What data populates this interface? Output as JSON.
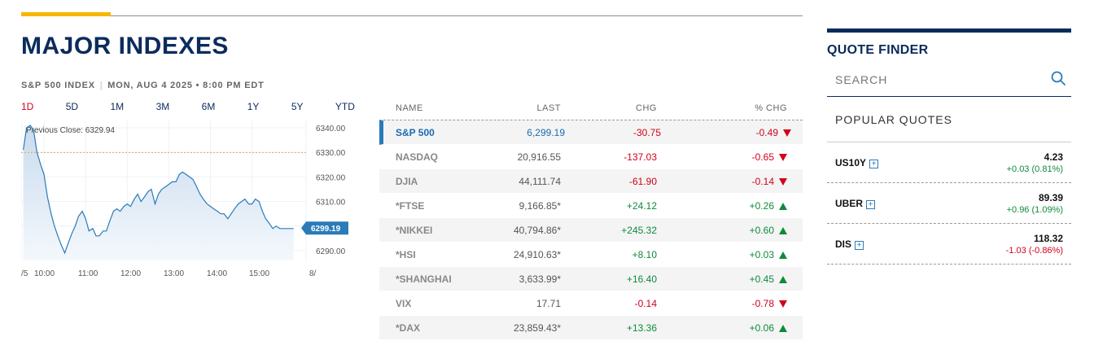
{
  "header": {
    "title": "MAJOR INDEXES"
  },
  "chart_meta": {
    "index": "S&P 500 INDEX",
    "date": "MON, AUG 4 2025 • 8:00 PM EDT"
  },
  "range_tabs": [
    "1D",
    "5D",
    "1M",
    "3M",
    "6M",
    "1Y",
    "5Y",
    "YTD"
  ],
  "range_active": "1D",
  "chart_data": {
    "type": "area",
    "previous_close_label": "Previous Close: 6329.94",
    "previous_close": 6329.94,
    "current_label": "6299.19",
    "current": 6299.19,
    "y_ticks": [
      "6340.00",
      "6330.00",
      "6320.00",
      "6310.00",
      "6300.00",
      "6290.00"
    ],
    "x_ticks": [
      "/5",
      "10:00",
      "11:00",
      "12:00",
      "13:00",
      "14:00",
      "15:00",
      "8/"
    ],
    "ylim": [
      6286,
      6343
    ],
    "series": [
      {
        "x": [
          9.5,
          9.58,
          9.67,
          9.75,
          9.83,
          9.92,
          10.0,
          10.08,
          10.17,
          10.25,
          10.33,
          10.42,
          10.5,
          10.58,
          10.67,
          10.75,
          10.83,
          10.92,
          11.0,
          11.08,
          11.17,
          11.25,
          11.33,
          11.42,
          11.5,
          11.58,
          11.67,
          11.75,
          11.83,
          11.92,
          12.0,
          12.08,
          12.17,
          12.25,
          12.33,
          12.42,
          12.5,
          12.58,
          12.67,
          12.75,
          12.83,
          12.92,
          13.0,
          13.08,
          13.17,
          13.25,
          13.33,
          13.42,
          13.5,
          13.58,
          13.67,
          13.75,
          13.83,
          13.92,
          14.0,
          14.08,
          14.17,
          14.25,
          14.33,
          14.42,
          14.5,
          14.58,
          14.67,
          14.75,
          14.83,
          14.92,
          15.0,
          15.08,
          15.17,
          15.25,
          15.33,
          15.42,
          15.5,
          15.58,
          15.67,
          15.75,
          15.83,
          15.92,
          16.0
        ],
        "values": [
          6331,
          6340,
          6341,
          6339,
          6330,
          6325,
          6321,
          6312,
          6305,
          6300,
          6296,
          6292,
          6289,
          6293,
          6297,
          6300,
          6304,
          6306,
          6303,
          6298,
          6299,
          6296,
          6296,
          6298,
          6298,
          6302,
          6306,
          6307,
          6306,
          6308,
          6309,
          6308,
          6311,
          6313,
          6310,
          6312,
          6314,
          6315,
          6309,
          6313,
          6315,
          6316,
          6317,
          6318,
          6318,
          6321,
          6322,
          6321,
          6320,
          6319,
          6316,
          6313,
          6311,
          6309,
          6308,
          6307,
          6306,
          6305,
          6305,
          6303,
          6305,
          6307,
          6309,
          6310,
          6311,
          6309,
          6309,
          6311,
          6310,
          6306,
          6303,
          6301,
          6299,
          6300,
          6299,
          6299,
          6299,
          6299,
          6299
        ]
      }
    ]
  },
  "table": {
    "headers": {
      "name": "NAME",
      "last": "LAST",
      "chg": "CHG",
      "pct": "% CHG"
    },
    "rows": [
      {
        "name": "S&P 500",
        "last": "6,299.19",
        "chg": "-30.75",
        "pct": "-0.49",
        "dir": "down"
      },
      {
        "name": "NASDAQ",
        "last": "20,916.55",
        "chg": "-137.03",
        "pct": "-0.65",
        "dir": "down"
      },
      {
        "name": "DJIA",
        "last": "44,111.74",
        "chg": "-61.90",
        "pct": "-0.14",
        "dir": "down"
      },
      {
        "name": "*FTSE",
        "last": "9,166.85*",
        "chg": "+24.12",
        "pct": "+0.26",
        "dir": "up"
      },
      {
        "name": "*NIKKEI",
        "last": "40,794.86*",
        "chg": "+245.32",
        "pct": "+0.60",
        "dir": "up"
      },
      {
        "name": "*HSI",
        "last": "24,910.63*",
        "chg": "+8.10",
        "pct": "+0.03",
        "dir": "up"
      },
      {
        "name": "*SHANGHAI",
        "last": "3,633.99*",
        "chg": "+16.40",
        "pct": "+0.45",
        "dir": "up"
      },
      {
        "name": "VIX",
        "last": "17.71",
        "chg": "-0.14",
        "pct": "-0.78",
        "dir": "down"
      },
      {
        "name": "*DAX",
        "last": "23,859.43*",
        "chg": "+13.36",
        "pct": "+0.06",
        "dir": "up"
      }
    ]
  },
  "quote_finder": {
    "title": "QUOTE FINDER",
    "search_placeholder": "SEARCH",
    "popular_title": "POPULAR QUOTES",
    "quotes": [
      {
        "symbol": "US10Y",
        "price": "4.23",
        "change": "+0.03 (0.81%)",
        "dir": "up"
      },
      {
        "symbol": "UBER",
        "price": "89.39",
        "change": "+0.96 (1.09%)",
        "dir": "up"
      },
      {
        "symbol": "DIS",
        "price": "118.32",
        "change": "-1.03 (-0.86%)",
        "dir": "down"
      }
    ]
  },
  "colors": {
    "navy": "#0b2b5c",
    "gold": "#f5b700",
    "up": "#0f8a3c",
    "down": "#d0021b",
    "line": "#2a7bb8",
    "fill": "#dbe7f3"
  },
  "icons": {
    "search": "search-icon",
    "add": "plus-icon",
    "up": "triangle-up-icon",
    "down": "triangle-down-icon"
  }
}
